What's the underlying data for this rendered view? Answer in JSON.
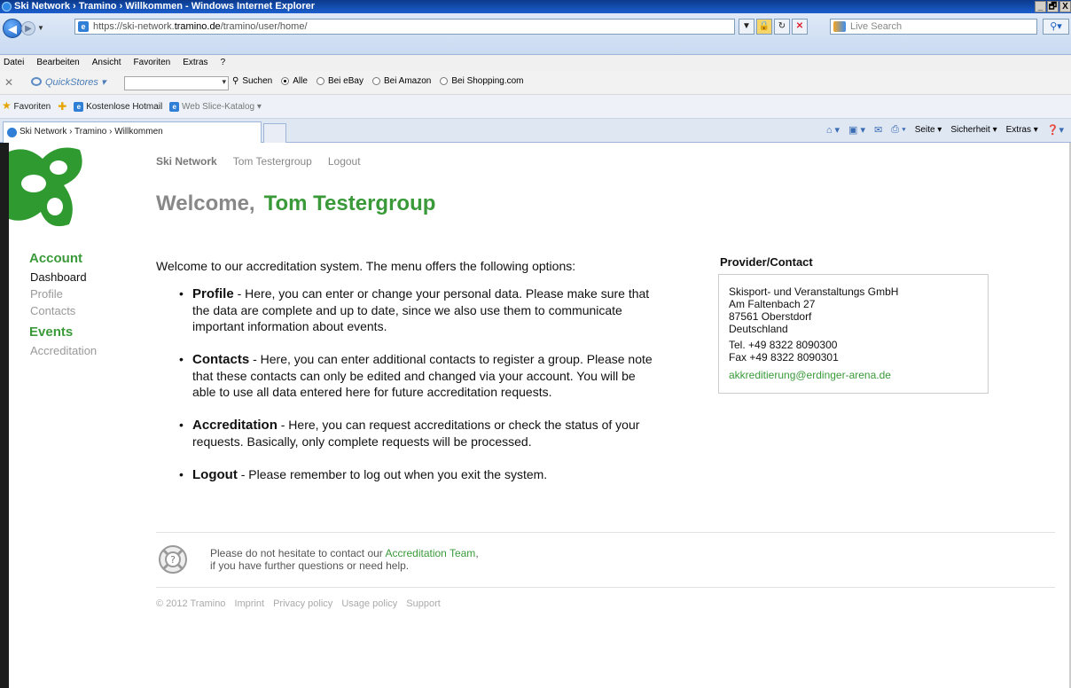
{
  "window": {
    "title": "Ski Network › Tramino › Willkommen - Windows Internet Explorer",
    "buttons": [
      "_",
      "🗗",
      "X"
    ]
  },
  "address": {
    "url_prefix": "https://ski-network.",
    "url_host": "tramino.de",
    "url_path": "/tramino/user/home/",
    "search_placeholder": "Live Search"
  },
  "menubar": [
    "Datei",
    "Bearbeiten",
    "Ansicht",
    "Favoriten",
    "Extras",
    "?"
  ],
  "quickstores": {
    "label": "QuickStores",
    "search_label": "Suchen",
    "options": [
      "Alle",
      "Bei eBay",
      "Bei Amazon",
      "Bei Shopping.com"
    ]
  },
  "favorites": {
    "label": "Favoriten",
    "items": [
      "Kostenlose Hotmail",
      "Web Slice-Katalog"
    ]
  },
  "tab": {
    "label": "Ski Network › Tramino › Willkommen"
  },
  "commandbar": [
    "Seite",
    "Sicherheit",
    "Extras"
  ],
  "page": {
    "topnav": {
      "brand": "Ski Network",
      "user": "Tom Testergroup",
      "logout": "Logout"
    },
    "welcome_prefix": "Welcome,",
    "welcome_user": "Tom Testergroup",
    "sidebar": {
      "account_heading": "Account",
      "account_items": [
        "Dashboard",
        "Profile",
        "Contacts"
      ],
      "events_heading": "Events",
      "events_items": [
        "Accreditation"
      ]
    },
    "intro": "Welcome to our accreditation system. The menu offers the following options:",
    "options": [
      {
        "title": "Profile",
        "text": " - Here, you can enter or change your personal data. Please make sure that the data are complete and up to date, since we also use them to communicate important information about events."
      },
      {
        "title": "Contacts",
        "text": " - Here, you can enter additional contacts to register a group. Please note that these contacts can only be edited and changed via your account. You will be able to use all data entered here for future accreditation requests."
      },
      {
        "title": "Accreditation",
        "text": " - Here, you can request accreditations or check the status of your requests. Basically, only complete requests will be processed."
      },
      {
        "title": "Logout",
        "text": " - Please remember to log out when you exit the system."
      }
    ],
    "provider": {
      "title": "Provider/Contact",
      "company": "Skisport- und Veranstaltungs GmbH",
      "street": "Am Faltenbach 27",
      "city": "87561 Oberstdorf",
      "country": "Deutschland",
      "tel": "Tel. +49 8322 8090300",
      "fax": "Fax +49 8322 8090301",
      "email": "akkreditierung@erdinger-arena.de"
    },
    "help": {
      "line1_prefix": "Please do not hesitate to contact our ",
      "line1_link": "Accreditation Team",
      "line1_suffix": ",",
      "line2": "if you have further questions or need help."
    },
    "footer": [
      "© 2012 Tramino",
      "Imprint",
      "Privacy policy",
      "Usage policy",
      "Support"
    ]
  },
  "colors": {
    "brand_green": "#3a9a3a",
    "ie_blue": "#1c5fce"
  }
}
